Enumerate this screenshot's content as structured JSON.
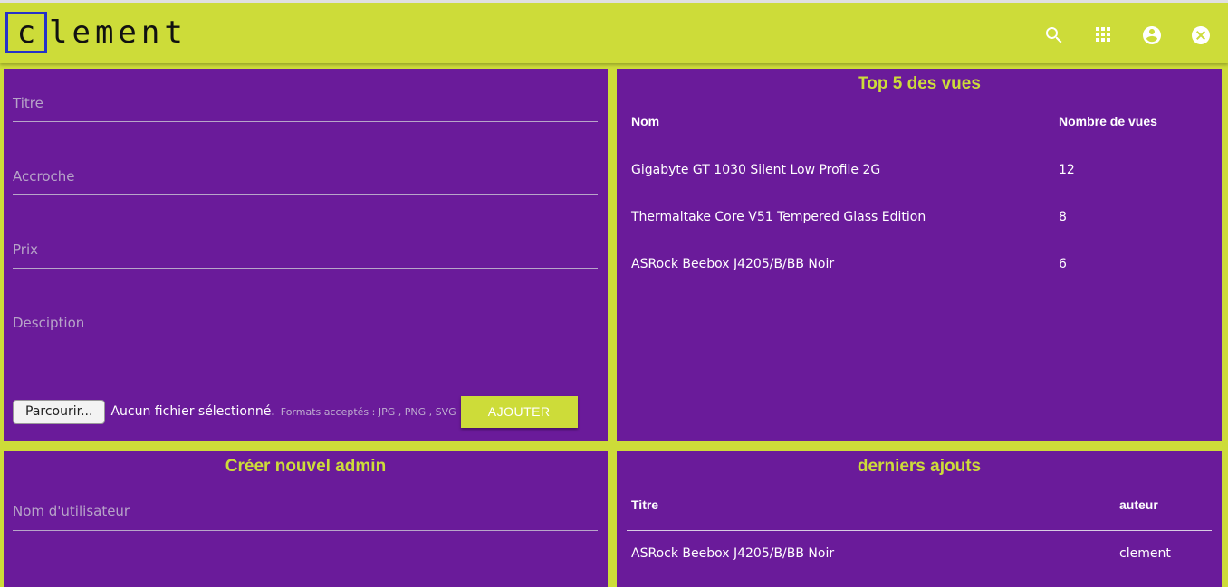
{
  "header": {
    "logo_first_letter": "c",
    "logo_rest": "lement",
    "icons": [
      "search-icon",
      "apps-grid-icon",
      "account-circle-icon",
      "close-circle-icon"
    ],
    "accent_color": "#cddc39",
    "panel_color": "#6a1b9a",
    "logo_border_color": "#2632c8"
  },
  "product_form": {
    "title_label": "Titre",
    "hook_label": "Accroche",
    "price_label": "Prix",
    "description_label": "Desciption",
    "browse_label": "Parcourir...",
    "no_file_text": "Aucun fichier sélectionné.",
    "formats_text": "Formats acceptés : JPG , PNG , SVG",
    "add_label": "AJOUTER"
  },
  "top_views": {
    "title": "Top 5 des vues",
    "columns": [
      "Nom",
      "Nombre de vues"
    ],
    "rows": [
      {
        "name": "Gigabyte GT 1030 Silent Low Profile 2G",
        "views": "12"
      },
      {
        "name": "Thermaltake Core V51 Tempered Glass Edition",
        "views": "8"
      },
      {
        "name": "ASRock Beebox J4205/B/BB Noir",
        "views": "6"
      }
    ]
  },
  "new_admin": {
    "title": "Créer nouvel admin",
    "username_label": "Nom d'utilisateur"
  },
  "latest": {
    "title": "derniers ajouts",
    "columns": [
      "Titre",
      "auteur"
    ],
    "rows": [
      {
        "title": "ASRock Beebox J4205/B/BB Noir",
        "author": "clement"
      }
    ]
  }
}
